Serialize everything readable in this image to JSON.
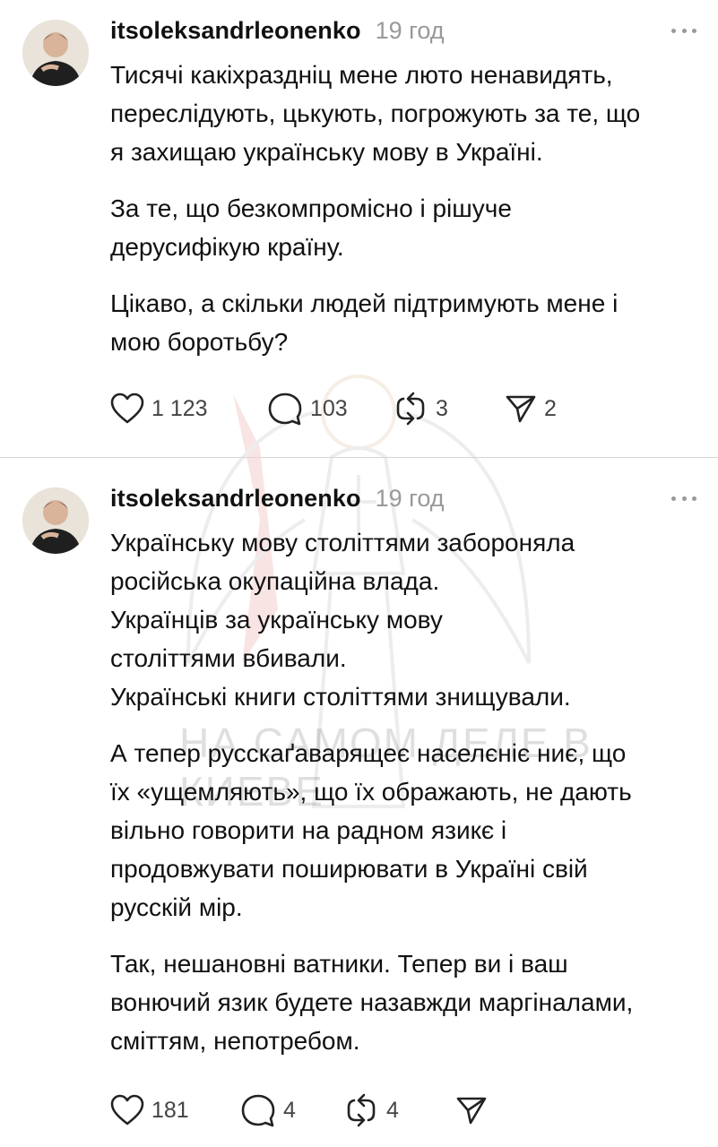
{
  "watermark_text": "НА САМОМ ДЕЛЕ В КИЕВЕ",
  "posts": [
    {
      "username": "itsoleksandrleonenko",
      "time": "19 год",
      "paragraphs": [
        "Тисячі какіхраздніц мене люто ненавидять,\nпереслідують, цькують, погрожують за те, що\nя захищаю українську мову в Україні.",
        "За те, що безкомпромісно і рішуче\nдерусифікую країну.",
        "Цікаво, а скільки людей підтримують мене і\nмою боротьбу?"
      ],
      "likes": "1 123",
      "replies": "103",
      "reposts": "3",
      "shares": "2"
    },
    {
      "username": "itsoleksandrleonenko",
      "time": "19 год",
      "paragraphs": [
        "Українську мову століттями забороняла\nросійська окупаційна влада.\nУкраїнців за українську мову\nстоліттями вбивали.\nУкраїнські книги століттями знищували.",
        "А тепер русскаґаварящеє населєніє ниє, що\nїх «ущемляють», що їх ображають, не дають\nвільно говорити на радном язикє і\nпродовжувати поширювати в Україні свій\nрусскій мір.",
        "Так, нешановні ватники. Тепер ви і ваш\nвонючий язик будете назавжди маргіналами,\nсміттям, непотребом."
      ],
      "likes": "181",
      "replies": "4",
      "reposts": "4",
      "shares": ""
    }
  ],
  "icons": {
    "like": "heart-icon",
    "reply": "comment-icon",
    "repost": "repost-icon",
    "share": "send-icon",
    "more": "more-icon"
  }
}
